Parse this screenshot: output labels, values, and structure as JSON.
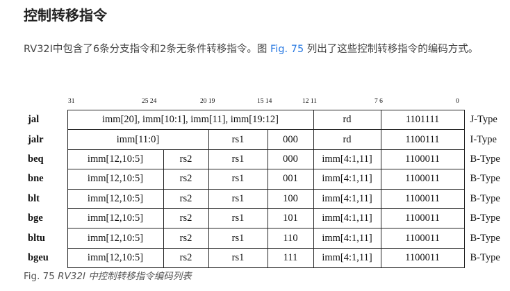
{
  "heading": "控制转移指令",
  "paragraph": {
    "before": "RV32I中包含了6条分支指令和2条无条件转移指令。图 ",
    "link": "Fig. 75",
    "after": " 列出了这些控制转移指令的编码方式。"
  },
  "bit_positions": [
    "31",
    "25 24",
    "20 19",
    "15 14",
    "12 11",
    "7 6",
    "0"
  ],
  "rows": [
    {
      "mnemonic": "jal",
      "fields": [
        "imm[20], imm[10:1], imm[11], imm[19:12]",
        "rd",
        "1101111"
      ],
      "type": "J-Type"
    },
    {
      "mnemonic": "jalr",
      "fields": [
        "imm[11:0]",
        "rs1",
        "000",
        "rd",
        "1100111"
      ],
      "type": "I-Type"
    },
    {
      "mnemonic": "beq",
      "fields": [
        "imm[12,10:5]",
        "rs2",
        "rs1",
        "000",
        "imm[4:1,11]",
        "1100011"
      ],
      "type": "B-Type"
    },
    {
      "mnemonic": "bne",
      "fields": [
        "imm[12,10:5]",
        "rs2",
        "rs1",
        "001",
        "imm[4:1,11]",
        "1100011"
      ],
      "type": "B-Type"
    },
    {
      "mnemonic": "blt",
      "fields": [
        "imm[12,10:5]",
        "rs2",
        "rs1",
        "100",
        "imm[4:1,11]",
        "1100011"
      ],
      "type": "B-Type"
    },
    {
      "mnemonic": "bge",
      "fields": [
        "imm[12,10:5]",
        "rs2",
        "rs1",
        "101",
        "imm[4:1,11]",
        "1100011"
      ],
      "type": "B-Type"
    },
    {
      "mnemonic": "bltu",
      "fields": [
        "imm[12,10:5]",
        "rs2",
        "rs1",
        "110",
        "imm[4:1,11]",
        "1100011"
      ],
      "type": "B-Type"
    },
    {
      "mnemonic": "bgeu",
      "fields": [
        "imm[12,10:5]",
        "rs2",
        "rs1",
        "111",
        "imm[4:1,11]",
        "1100011"
      ],
      "type": "B-Type"
    }
  ],
  "caption": {
    "label": "Fig. 75 ",
    "text": "RV32I 中控制转移指令编码列表"
  }
}
